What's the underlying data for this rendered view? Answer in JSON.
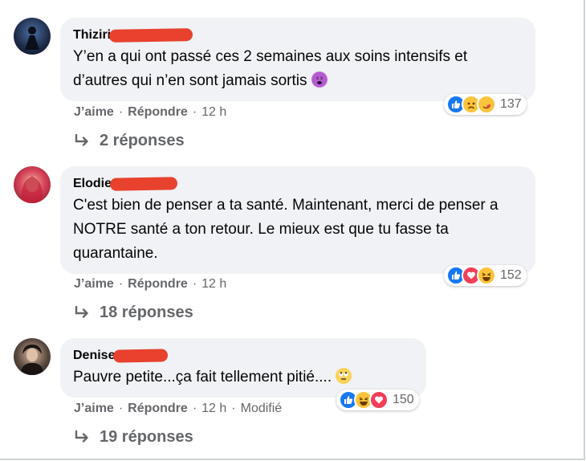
{
  "comments": [
    {
      "author": "Thiziri",
      "text": "Y’en a qui ont passé ces 2 semaines aux soins intensifs et d’autres qui n’en sont jamais sortis",
      "trailing_emoji": "dizzy-face",
      "reaction_count": "137",
      "reactions": [
        "like",
        "sad",
        "care"
      ],
      "like_label": "J’aime",
      "reply_label": "Répondre",
      "time": "12 h",
      "edited": "",
      "replies_label": "2 réponses"
    },
    {
      "author": "Elodie",
      "text": "C'est bien de penser a ta santé. Maintenant, merci de penser a NOTRE santé a ton retour. Le mieux est que tu fasse ta quarantaine.",
      "trailing_emoji": "",
      "reaction_count": "152",
      "reactions": [
        "like",
        "love",
        "haha"
      ],
      "like_label": "J’aime",
      "reply_label": "Répondre",
      "time": "12 h",
      "edited": "",
      "replies_label": "18 réponses"
    },
    {
      "author": "Denise",
      "text": "Pauvre petite...ça fait tellement pitié....",
      "trailing_emoji": "rolling-eyes",
      "reaction_count": "150",
      "reactions": [
        "like",
        "haha",
        "love"
      ],
      "like_label": "J’aime",
      "reply_label": "Répondre",
      "time": "12 h",
      "edited": "Modifié",
      "replies_label": "19 réponses"
    }
  ],
  "separator": "·",
  "colors": {
    "bubble": "#f0f2f5",
    "like": "#1877f2",
    "love": "#f33e58",
    "emoji_yellow": "#fbc43c",
    "redaction": "#e8412e",
    "muted": "#65676b"
  }
}
